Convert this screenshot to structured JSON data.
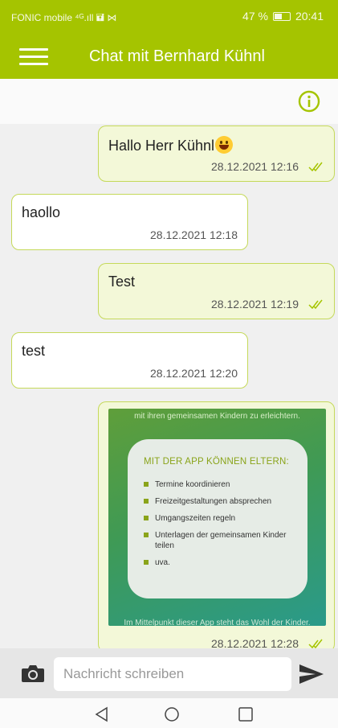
{
  "status_bar": {
    "carrier": "FONIC mobile ⁴ᴳ.ıll 🖬 ⋈",
    "battery_text": "47 %",
    "time": "20:41"
  },
  "app_bar": {
    "title": "Chat mit Bernhard Kühnl",
    "menu_icon": "hamburger-menu-icon",
    "info_icon": "info-icon"
  },
  "colors": {
    "brand": "#a5c400",
    "outgoing_bubble": "#f3f8d8",
    "bubble_border": "#c5d95a"
  },
  "messages": [
    {
      "direction": "out",
      "text": "Hallo Herr Kühnl",
      "emoji": "grinning-face",
      "time": "28.12.2021 12:16",
      "read": true
    },
    {
      "direction": "in",
      "text": "haollo",
      "time": "28.12.2021 12:18"
    },
    {
      "direction": "out",
      "text": "Test",
      "time": "28.12.2021 12:19",
      "read": true
    },
    {
      "direction": "in",
      "text": "test",
      "time": "28.12.2021 12:20"
    },
    {
      "direction": "out",
      "type": "image",
      "time": "28.12.2021 12:28",
      "read": true,
      "image": {
        "top_text": "mit ihren gemeinsamen Kindern zu erleichtern.",
        "card_title": "MIT DER APP KÖNNEN ELTERN:",
        "items": [
          "Termine koordinieren",
          "Freizeitgestaltungen absprechen",
          "Umgangszeiten regeln",
          "Unterlagen der gemeinsamen Kinder teilen",
          "uva."
        ],
        "bottom_text": "Im Mittelpunkt dieser App steht das Wohl der Kinder."
      }
    }
  ],
  "composer": {
    "placeholder": "Nachricht schreiben",
    "value": "",
    "camera_icon": "camera-icon",
    "send_icon": "send-icon"
  },
  "nav_bar": {
    "back_icon": "back-triangle-icon",
    "home_icon": "home-circle-icon",
    "recents_icon": "recents-square-icon"
  }
}
